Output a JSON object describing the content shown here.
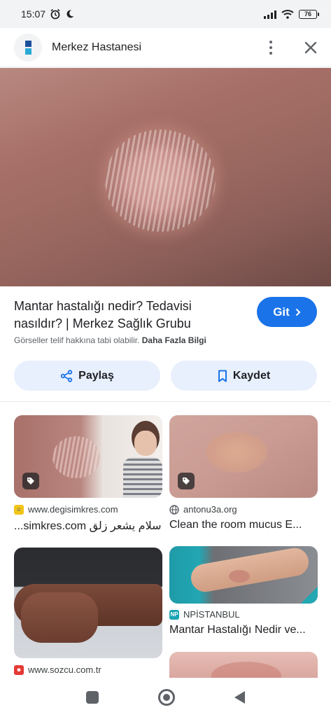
{
  "status_bar": {
    "time": "15:07",
    "battery": "76"
  },
  "header": {
    "site_name": "Merkez Hastanesi"
  },
  "info": {
    "title": "Mantar hastalığı nedir? Tedavisi nasıldır? | Merkez Sağlık Grubu",
    "go_label": "Git",
    "copyright_text": "Görseller telif hakkına tabi olabilir.",
    "more_info_label": "Daha Fazla Bilgi",
    "share_label": "Paylaş",
    "save_label": "Kaydet"
  },
  "results": [
    {
      "source": "www.degisimkres.com",
      "title": "...simkres.com سلام يشعر زلق"
    },
    {
      "source": "antonu3a.org",
      "title": "Clean the room mucus E..."
    },
    {
      "source": "www.sozcu.com.tr",
      "title": ""
    },
    {
      "source": "NPİSTANBUL",
      "favicon_text": "NP",
      "title": "Mantar Hastalığı Nedir ve..."
    }
  ],
  "colors": {
    "accent": "#1a73e8",
    "chip_bg": "#e8f0fe",
    "logo_top": "#1b4f9c",
    "logo_bottom": "#29a9d6"
  },
  "icons": [
    "clock-icon",
    "moon-icon",
    "signal-icon",
    "wifi-icon",
    "battery-icon",
    "more-vert-icon",
    "close-icon",
    "chevron-right-icon",
    "share-icon",
    "bookmark-icon",
    "tag-icon",
    "globe-icon"
  ]
}
